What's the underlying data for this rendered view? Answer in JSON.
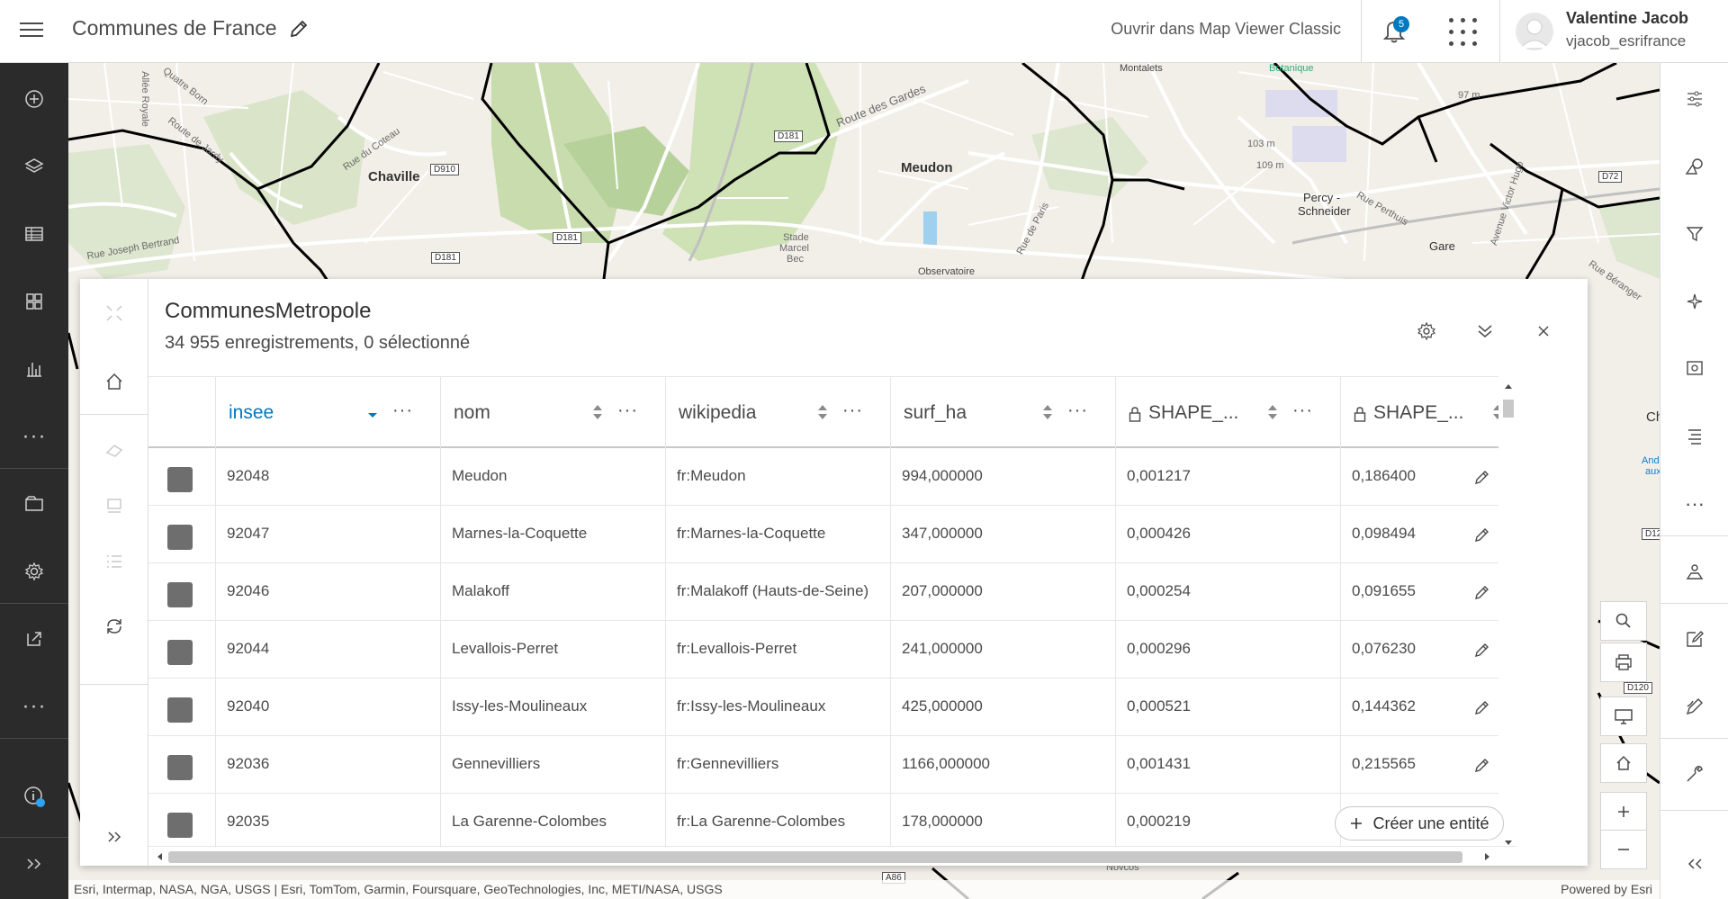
{
  "header": {
    "app_title": "Communes de France",
    "open_classic": "Ouvrir dans Map Viewer Classic",
    "notifications_count": "5",
    "user_name": "Valentine Jacob",
    "user_id": "vjacob_esrifrance"
  },
  "left_bar": {
    "items": [
      {
        "name": "add-icon"
      },
      {
        "name": "layers-icon"
      },
      {
        "name": "table-icon"
      },
      {
        "name": "basemap-icon"
      },
      {
        "name": "charts-icon"
      },
      {
        "name": "more-icon"
      },
      {
        "name": "map-properties-icon"
      },
      {
        "name": "settings-icon"
      },
      {
        "name": "share-icon"
      },
      {
        "name": "more-icon"
      },
      {
        "name": "info-icon"
      },
      {
        "name": "expand-icon"
      }
    ]
  },
  "right_bar": {
    "items": [
      {
        "name": "properties-icon"
      },
      {
        "name": "styles-icon"
      },
      {
        "name": "filter-icon"
      },
      {
        "name": "effects-icon"
      },
      {
        "name": "popups-icon"
      },
      {
        "name": "labels-icon"
      },
      {
        "name": "more-icon"
      },
      {
        "name": "analysis-icon"
      },
      {
        "name": "edit-icon"
      },
      {
        "name": "sketch-icon"
      },
      {
        "name": "tools-icon"
      },
      {
        "name": "collapse-icon"
      }
    ]
  },
  "map": {
    "labels": {
      "chaville": "Chaville",
      "meudon": "Meudon",
      "gare": "Gare",
      "percy": "Percy -",
      "schneider": "Schneider",
      "stade1": "Stade",
      "stade2": "Marcel",
      "stade3": "Bec",
      "observatoire": "Observatoire",
      "montalets": "Montalets",
      "botanique": "Botanique",
      "route_gardes": "Route des Gardes",
      "route_coteau": "Rue du Coteau",
      "route_jardy": "Route de Jardy",
      "quatre_borne": "Quatre Born",
      "allee_royale": "Allée Royale",
      "joseph_bertrand": "Rue Joseph Bertrand",
      "rue_paris": "Rue de Paris",
      "rue_perthuis": "Rue Perthuis",
      "victor_hugo": "Avenue Victor Hugo",
      "rue_beranger": "Rue Béranger",
      "ch": "Ch",
      "andre": "André",
      "aux": "aux",
      "novcos": "Novcos",
      "alt1": "97 m",
      "alt2": "103 m",
      "alt3": "109 m",
      "d910": "D910",
      "d181a": "D181",
      "d181b": "D181",
      "d181c": "D181",
      "d72": "D72",
      "d12": "D12",
      "d120": "D120",
      "a86": "A86"
    },
    "attribution": "Esri, Intermap, NASA, NGA, USGS | Esri, TomTom, Garmin, Foursquare, GeoTechnologies, Inc, METI/NASA, USGS",
    "powered_by": "Powered by Esri"
  },
  "table": {
    "title": "CommunesMetropole",
    "subtitle": "34 955 enregistrements, 0 sélectionné",
    "columns": [
      {
        "label": "insee"
      },
      {
        "label": "nom"
      },
      {
        "label": "wikipedia"
      },
      {
        "label": "surf_ha"
      },
      {
        "label": "SHAPE_..."
      },
      {
        "label": "SHAPE_..."
      }
    ],
    "rows": [
      [
        "92048",
        "Meudon",
        "fr:Meudon",
        "994,000000",
        "0,001217",
        "0,186400"
      ],
      [
        "92047",
        "Marnes-la-Coquette",
        "fr:Marnes-la-Coquette",
        "347,000000",
        "0,000426",
        "0,098494"
      ],
      [
        "92046",
        "Malakoff",
        "fr:Malakoff (Hauts-de-Seine)",
        "207,000000",
        "0,000254",
        "0,091655"
      ],
      [
        "92044",
        "Levallois-Perret",
        "fr:Levallois-Perret",
        "241,000000",
        "0,000296",
        "0,076230"
      ],
      [
        "92040",
        "Issy-les-Moulineaux",
        "fr:Issy-les-Moulineaux",
        "425,000000",
        "0,000521",
        "0,144362"
      ],
      [
        "92036",
        "Gennevilliers",
        "fr:Gennevilliers",
        "1166,000000",
        "0,001431",
        "0,215565"
      ],
      [
        "92035",
        "La Garenne-Colombes",
        "fr:La Garenne-Colombes",
        "178,000000",
        "0,000219",
        ""
      ]
    ],
    "create_label": "Créer une entité"
  },
  "colors": {
    "accent": "#0079c1",
    "sidebar_bg": "#2b2b2b",
    "map_bg": "#f2efe9",
    "forest": "#c8dcae",
    "boundary": "#000000"
  }
}
